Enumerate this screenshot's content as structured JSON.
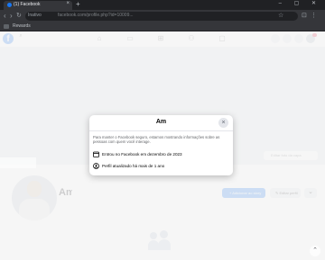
{
  "browser": {
    "tab_title": "(1) Facebook",
    "tab_close": "×",
    "new_tab": "+",
    "window_controls": "– ▢ ✕",
    "back": "‹",
    "forward": "›",
    "reload": "↻",
    "omnibox_tag": "Inativo",
    "url": "facebook.com/profile.php?id=10009..."
  },
  "bookmarks": {
    "item": "Rewards"
  },
  "facebook": {
    "logo": "f"
  },
  "cover": {
    "edit_label": "Editar foto da capa"
  },
  "profile": {
    "name_fragment": "Am",
    "primary_button": "+ Adicionar ao story",
    "secondary_button": "✎ Editar perfil",
    "more_button": "⌄"
  },
  "modal": {
    "title": "Am",
    "close": "×",
    "description": "Para manter o Facebook seguro, estamos mostrando informações sobre as pessoas com quem você interage.",
    "row1_text": "Entrou no Facebook em dezembro de 2023",
    "row2_text": "Perfil atualizado há mais de 1 ano"
  },
  "scroll_arrow": "⌃"
}
